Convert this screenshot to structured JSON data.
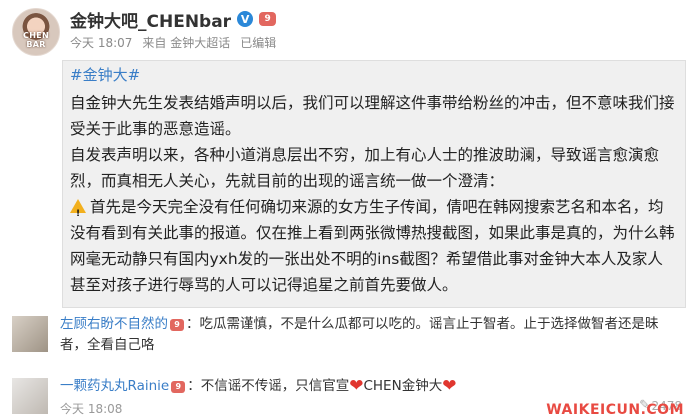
{
  "post": {
    "author": "金钟大吧_CHENbar",
    "avatar_caption": "CHEN BAR",
    "verified_icon": "V",
    "level_icon": "9",
    "time": "今天 18:07",
    "source": "来自 金钟大超话",
    "edited": "已编辑",
    "topic": "#金钟大#",
    "paragraphs": [
      "自金钟大先生发表结婚声明以后，我们可以理解这件事带给粉丝的冲击，但不意味我们接受关于此事的恶意造谣。",
      "自发表声明以来，各种小道消息层出不穷，加上有心人士的推波助澜，导致谣言愈演愈烈，而真相无人关心，先就目前的出现的谣言统一做一个澄清：",
      "首先是今天完全没有任何确切来源的女方生子传闻，倩吧在韩网搜索艺名和本名，均没有看到有关此事的报道。仅在推上看到两张微博热搜截图，如果此事是真的，为什么韩网毫无动静只有国内yxh发的一张出处不明的ins截图？希望借此事对金钟大本人及家人甚至对孩子进行辱骂的人可以记得追星之前首先要做人。"
    ]
  },
  "comments": [
    {
      "user": "左顾右盼不自然的",
      "text": "：吃瓜需谨慎，不是什么瓜都可以吃的。谣言止于智者。止于选择做智者还是昧者，全看自己咯"
    },
    {
      "user": "一颗药丸丸Rainie",
      "text_a": "：不信谣不传谣，只信官宣",
      "text_b": "CHEN金钟大",
      "time": "今天 18:08",
      "count": "2478"
    }
  ],
  "watermark": "WAIKEICUN.COM",
  "colors": {
    "link": "#3a7ec7",
    "badge": "#e2675f",
    "heart": "#e0362f",
    "verified": "#2b88d8"
  },
  "icons": [
    "warning-icon",
    "heart-icon",
    "reply-icon"
  ]
}
